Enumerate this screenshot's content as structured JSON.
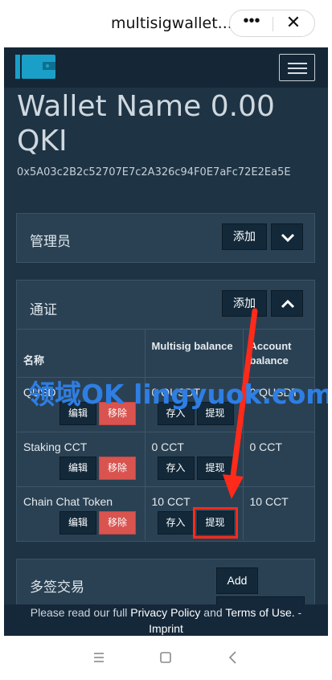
{
  "topbar": {
    "title": "multisigwallet....",
    "more_icon": "•••",
    "close_icon": "✕"
  },
  "wallet": {
    "title": "Wallet Name 0.00 QKI",
    "address": "0x5A03c2B2c52707E7c2A326c94F0E7aFc72E2Ea5E"
  },
  "admins": {
    "title": "管理员",
    "add_label": "添加"
  },
  "tokens": {
    "title": "通证",
    "add_label": "添加",
    "headers": {
      "name": "名称",
      "multisig": "Multisig balance",
      "account": "Account balance"
    },
    "rows": [
      {
        "name": "QUSDT",
        "edit": "编辑",
        "remove": "移除",
        "multisig": "0 QUSDT",
        "deposit": "存入",
        "withdraw": "提现",
        "account": "0 QUSDT"
      },
      {
        "name": "Staking CCT",
        "edit": "编辑",
        "remove": "移除",
        "multisig": "0 CCT",
        "deposit": "存入",
        "withdraw": "提现",
        "account": "0 CCT"
      },
      {
        "name": "Chain Chat Token",
        "edit": "编辑",
        "remove": "移除",
        "multisig": "10 CCT",
        "deposit": "存入",
        "withdraw": "提现",
        "account": "10 CCT"
      }
    ]
  },
  "transactions": {
    "title": "多签交易",
    "add_label": "Add"
  },
  "watermark": "领域OK lingyuok.com",
  "footer": {
    "prefix": "Please read our full ",
    "privacy": "Privacy Policy",
    "and": " and ",
    "terms": "Terms of Use.",
    "dash": " -",
    "imprint": "Imprint"
  },
  "colors": {
    "background": "#1e3344",
    "accent_red": "#d9534f",
    "annotation_red": "#ff2a1a",
    "watermark_blue": "#2e7ee3"
  },
  "icons": {
    "logo": "wallet-icon",
    "menu": "hamburger-icon",
    "nav_menu": "menu-lines-icon",
    "nav_home": "square-home-icon",
    "nav_back": "back-chevron-icon"
  }
}
